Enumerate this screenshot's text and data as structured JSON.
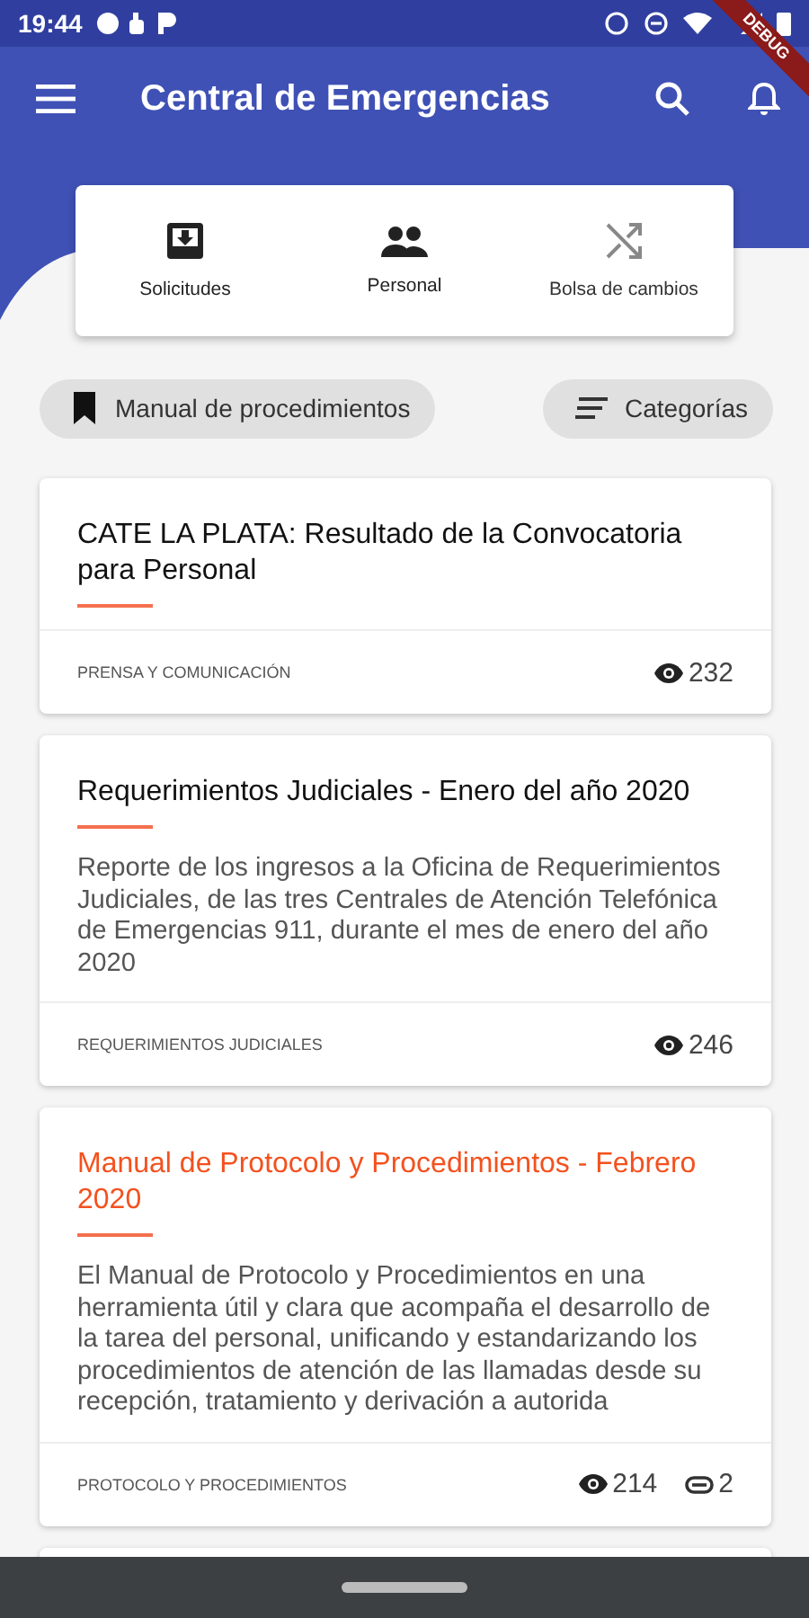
{
  "status_bar": {
    "time": "19:44"
  },
  "debug_banner": "DEBUG",
  "app_bar": {
    "title": "Central de Emergencias"
  },
  "shortcuts": [
    {
      "label": "Solicitudes",
      "disabled": false
    },
    {
      "label": "Personal",
      "disabled": false
    },
    {
      "label": "Bolsa de cambios",
      "disabled": true
    }
  ],
  "chips": [
    {
      "label": "Manual de procedimientos"
    },
    {
      "label": "Categorías"
    }
  ],
  "posts": [
    {
      "title": "CATE LA PLATA: Resultado de la Convocatoria para Personal",
      "highlighted": false,
      "category": "PRENSA Y COMUNICACIÓN",
      "views": "232"
    },
    {
      "title": " Requerimientos Judiciales - Enero del año 2020",
      "highlighted": false,
      "summary": "Reporte de los ingresos a la Oficina de Requerimientos Judiciales,  de las tres Centrales de Atención Telefónica  de Emergencias 911,  durante el mes de enero del año 2020",
      "category": "REQUERIMIENTOS JUDICIALES",
      "views": "246"
    },
    {
      "title": "Manual de Protocolo y Procedimientos - Febrero 2020",
      "highlighted": true,
      "summary": "El Manual de Protocolo y Procedimientos en una herramienta útil y clara que acompaña el desarrollo de la tarea del personal, unificando y estandarizando los procedimientos de atención de las llamadas desde su recepción, tratamiento y derivación a autorida",
      "category": "PROTOCOLO Y PROCEDIMIENTOS",
      "views": "214",
      "attachments": "2"
    }
  ]
}
